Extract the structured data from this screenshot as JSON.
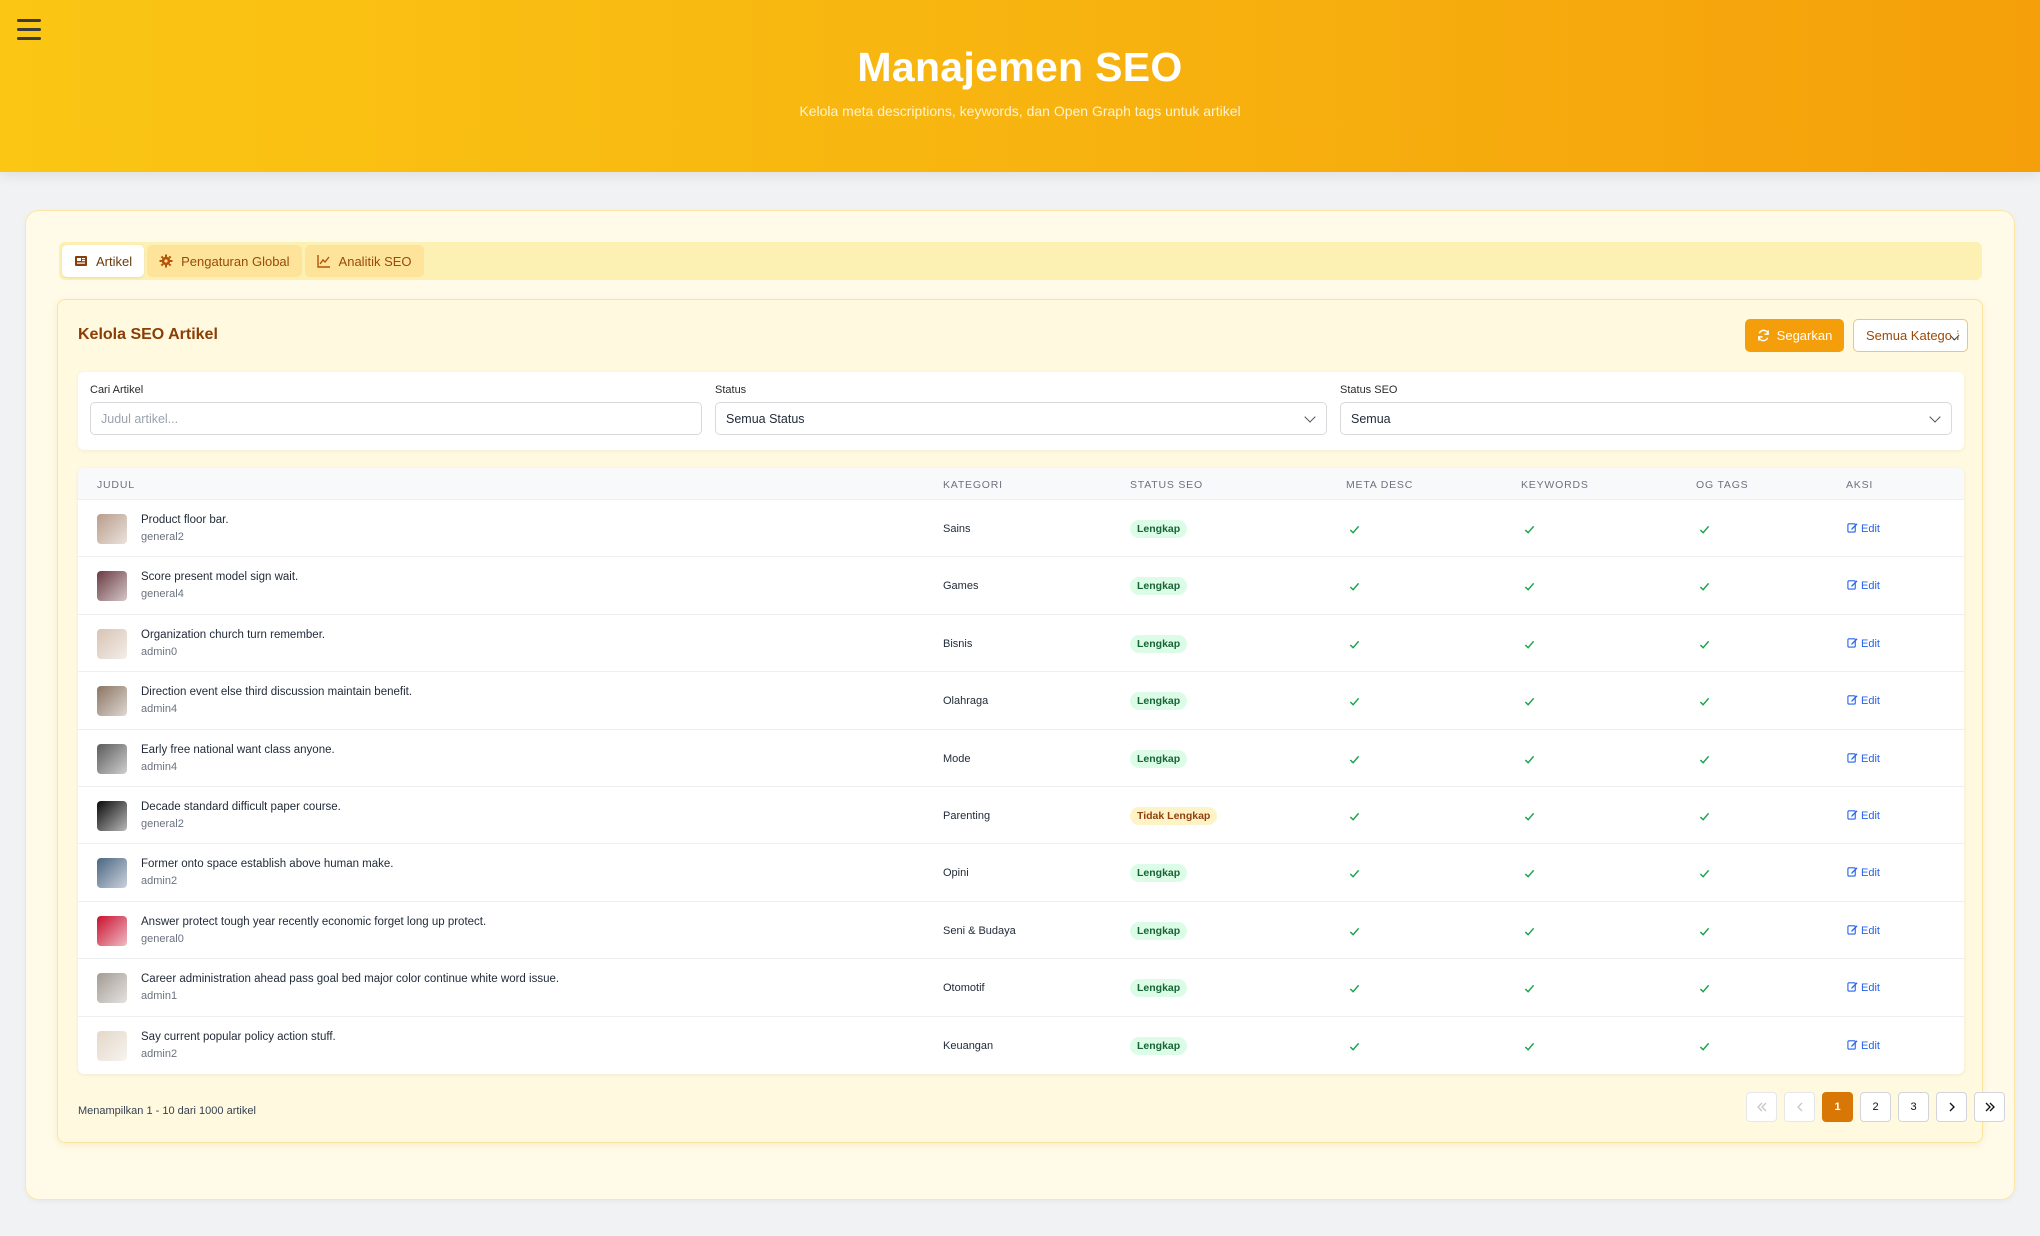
{
  "header": {
    "title": "Manajemen SEO",
    "subtitle": "Kelola meta descriptions, keywords, dan Open Graph tags untuk artikel"
  },
  "tabs": [
    {
      "label": "Artikel",
      "icon": "article-icon",
      "active": true
    },
    {
      "label": "Pengaturan Global",
      "icon": "gear-icon",
      "active": false
    },
    {
      "label": "Analitik SEO",
      "icon": "chart-line-icon",
      "active": false
    }
  ],
  "panel": {
    "title": "Kelola SEO Artikel",
    "refresh_label": "Segarkan",
    "category_select": "Semua Kategori"
  },
  "filters": {
    "search_label": "Cari Artikel",
    "search_placeholder": "Judul artikel...",
    "status_label": "Status",
    "status_value": "Semua Status",
    "seo_label": "Status SEO",
    "seo_value": "Semua"
  },
  "table": {
    "columns": [
      "Judul",
      "Kategori",
      "Status SEO",
      "Meta Desc",
      "Keywords",
      "OG Tags",
      "Aksi"
    ],
    "edit_label": "Edit",
    "rows": [
      {
        "title": "Product floor bar.",
        "author": "general2",
        "category": "Sains",
        "seo_status": "Lengkap",
        "complete": true,
        "thumb": "#b89c8a"
      },
      {
        "title": "Score present model sign wait.",
        "author": "general4",
        "category": "Games",
        "seo_status": "Lengkap",
        "complete": true,
        "thumb": "#6a3b42"
      },
      {
        "title": "Organization church turn remember.",
        "author": "admin0",
        "category": "Bisnis",
        "seo_status": "Lengkap",
        "complete": true,
        "thumb": "#d7c3b3"
      },
      {
        "title": "Direction event else third discussion maintain benefit.",
        "author": "admin4",
        "category": "Olahraga",
        "seo_status": "Lengkap",
        "complete": true,
        "thumb": "#8b7563"
      },
      {
        "title": "Early free national want class anyone.",
        "author": "admin4",
        "category": "Mode",
        "seo_status": "Lengkap",
        "complete": true,
        "thumb": "#5a5a5a"
      },
      {
        "title": "Decade standard difficult paper course.",
        "author": "general2",
        "category": "Parenting",
        "seo_status": "Tidak Lengkap",
        "complete": false,
        "thumb": "#0a0a0a"
      },
      {
        "title": "Former onto space establish above human make.",
        "author": "admin2",
        "category": "Opini",
        "seo_status": "Lengkap",
        "complete": true,
        "thumb": "#4a6583"
      },
      {
        "title": "Answer protect tough year recently economic forget long up protect.",
        "author": "general0",
        "category": "Seni & Budaya",
        "seo_status": "Lengkap",
        "complete": true,
        "thumb": "#c8102e"
      },
      {
        "title": "Career administration ahead pass goal bed major color continue white word issue.",
        "author": "admin1",
        "category": "Otomotif",
        "seo_status": "Lengkap",
        "complete": true,
        "thumb": "#a39b93"
      },
      {
        "title": "Say current popular policy action stuff.",
        "author": "admin2",
        "category": "Keuangan",
        "seo_status": "Lengkap",
        "complete": true,
        "thumb": "#e3d7c8"
      }
    ]
  },
  "footer": {
    "summary": "Menampilkan 1 - 10 dari 1000 artikel",
    "pages": [
      "1",
      "2",
      "3"
    ],
    "current_page": "1"
  },
  "colors": {
    "accent": "#f59e0b",
    "header_gradient_start": "#fbc614",
    "header_gradient_end": "#f5a00a",
    "check": "#16a34a",
    "link": "#2563eb"
  }
}
